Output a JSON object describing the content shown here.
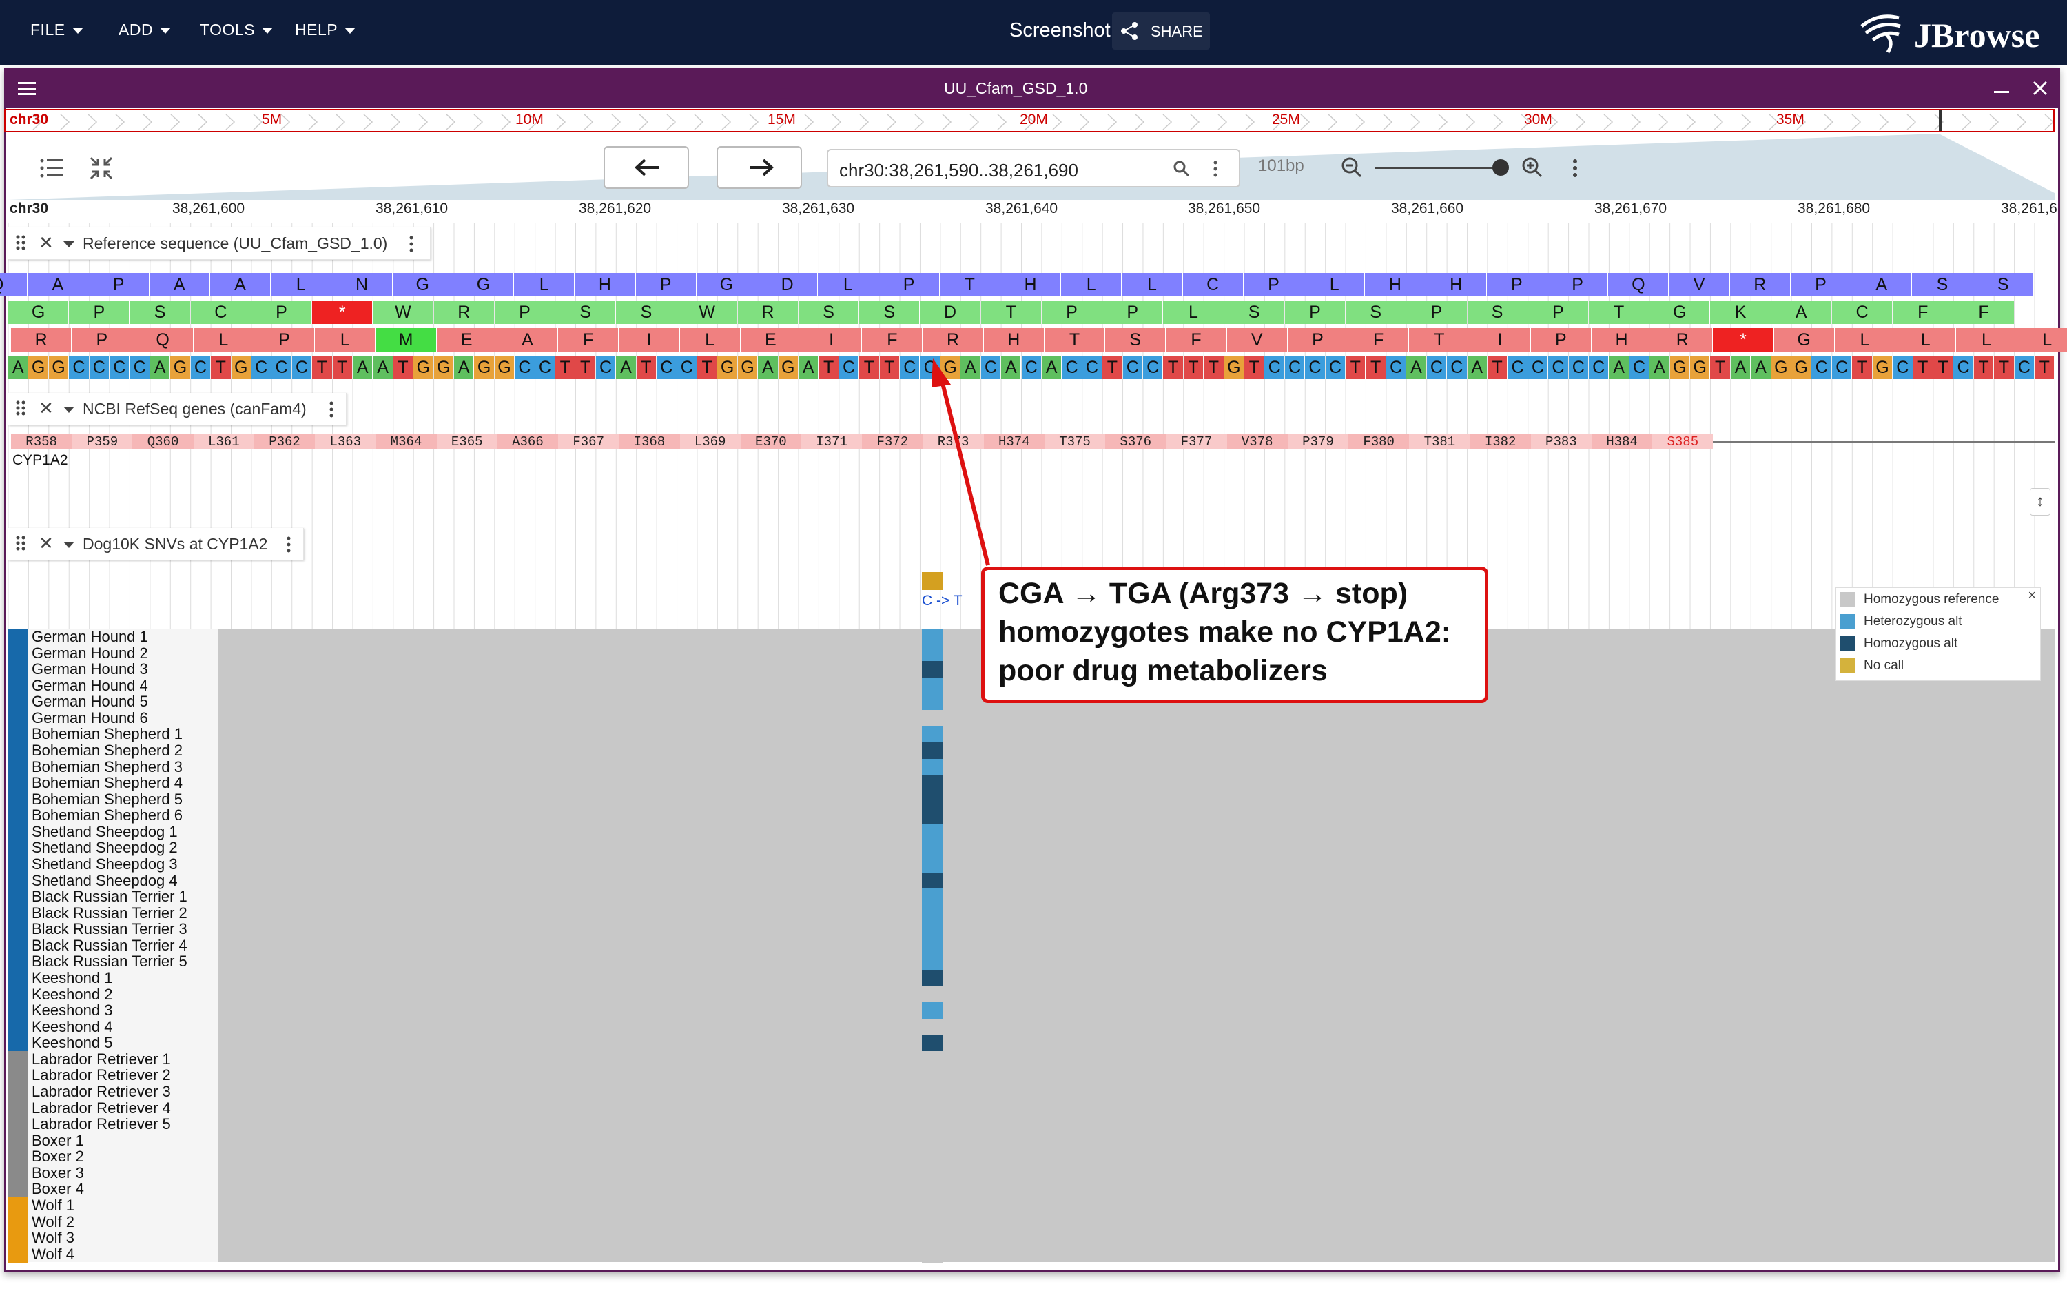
{
  "appbar": {
    "menus": [
      "FILE",
      "ADD",
      "TOOLS",
      "HELP"
    ],
    "screenshot_label": "Screenshot",
    "share_label": "SHARE",
    "logo_text": "JBrowse"
  },
  "view": {
    "title": "UU_Cfam_GSD_1.0",
    "overview": {
      "chrom": "chr30",
      "ticks": [
        "5M",
        "10M",
        "15M",
        "20M",
        "25M",
        "30M",
        "35M"
      ]
    },
    "location": "chr30:38,261,590..38,261,690",
    "bp_width": "101bp",
    "ruler": {
      "chrom": "chr30",
      "ticks": [
        "38,261,600",
        "38,261,610",
        "38,261,620",
        "38,261,630",
        "38,261,640",
        "38,261,650",
        "38,261,660",
        "38,261,670",
        "38,261,680",
        "38,261,6"
      ]
    }
  },
  "tracks": {
    "reference": {
      "name": "Reference sequence (UU_Cfam_GSD_1.0)",
      "frame1": [
        "Q",
        "A",
        "P",
        "A",
        "A",
        "L",
        "N",
        "G",
        "G",
        "L",
        "H",
        "P",
        "G",
        "D",
        "L",
        "P",
        "T",
        "H",
        "L",
        "L",
        "C",
        "P",
        "L",
        "H",
        "H",
        "P",
        "P",
        "Q",
        "V",
        "R",
        "P",
        "A",
        "S",
        "S"
      ],
      "frame2": [
        "G",
        "P",
        "S",
        "C",
        "P",
        "*",
        "W",
        "R",
        "P",
        "S",
        "S",
        "W",
        "R",
        "S",
        "S",
        "D",
        "T",
        "P",
        "P",
        "L",
        "S",
        "P",
        "S",
        "P",
        "S",
        "P",
        "T",
        "G",
        "K",
        "A",
        "C",
        "F",
        "F"
      ],
      "frame3": [
        "R",
        "P",
        "Q",
        "L",
        "P",
        "L",
        "M",
        "E",
        "A",
        "F",
        "I",
        "L",
        "E",
        "I",
        "F",
        "R",
        "H",
        "T",
        "S",
        "F",
        "V",
        "P",
        "F",
        "T",
        "I",
        "P",
        "H",
        "R",
        "*",
        "G",
        "L",
        "L",
        "L",
        "L"
      ],
      "dna": "AGGCCCCAGCTGCCCTTAATGGAGGCCTTCATCCTGGAGATCTTCCGACACACCTCCTTTGTCCCCTTCACCATCCCCCACAGGTAAGGCCTGCTTCTTCT"
    },
    "genes": {
      "name": "NCBI RefSeq genes (canFam4)",
      "gene_name": "CYP1A2",
      "residues": [
        "R358",
        "P359",
        "Q360",
        "L361",
        "P362",
        "L363",
        "M364",
        "E365",
        "A366",
        "F367",
        "I368",
        "L369",
        "E370",
        "I371",
        "F372",
        "R373",
        "H374",
        "T375",
        "S376",
        "F377",
        "V378",
        "P379",
        "F380",
        "T381",
        "I382",
        "P383",
        "H384",
        "S385"
      ]
    },
    "snvs": {
      "name": "Dog10K SNVs at CYP1A2",
      "variant_label": "C -> T",
      "samples": [
        {
          "name": "German Hound 1",
          "group": "German Hound",
          "gt": "het"
        },
        {
          "name": "German Hound 2",
          "group": "German Hound",
          "gt": "het"
        },
        {
          "name": "German Hound 3",
          "group": "German Hound",
          "gt": "homalt"
        },
        {
          "name": "German Hound 4",
          "group": "German Hound",
          "gt": "het"
        },
        {
          "name": "German Hound 5",
          "group": "German Hound",
          "gt": "het"
        },
        {
          "name": "German Hound 6",
          "group": "German Hound",
          "gt": "ref"
        },
        {
          "name": "Bohemian Shepherd 1",
          "group": "Bohemian Shepherd",
          "gt": "het"
        },
        {
          "name": "Bohemian Shepherd 2",
          "group": "Bohemian Shepherd",
          "gt": "homalt"
        },
        {
          "name": "Bohemian Shepherd 3",
          "group": "Bohemian Shepherd",
          "gt": "het"
        },
        {
          "name": "Bohemian Shepherd 4",
          "group": "Bohemian Shepherd",
          "gt": "homalt"
        },
        {
          "name": "Bohemian Shepherd 5",
          "group": "Bohemian Shepherd",
          "gt": "homalt"
        },
        {
          "name": "Bohemian Shepherd 6",
          "group": "Bohemian Shepherd",
          "gt": "homalt"
        },
        {
          "name": "Shetland Sheepdog 1",
          "group": "Shetland Sheepdog",
          "gt": "het"
        },
        {
          "name": "Shetland Sheepdog 2",
          "group": "Shetland Sheepdog",
          "gt": "het"
        },
        {
          "name": "Shetland Sheepdog 3",
          "group": "Shetland Sheepdog",
          "gt": "het"
        },
        {
          "name": "Shetland Sheepdog 4",
          "group": "Shetland Sheepdog",
          "gt": "homalt"
        },
        {
          "name": "Black Russian Terrier 1",
          "group": "Black Russian Terrier",
          "gt": "het"
        },
        {
          "name": "Black Russian Terrier 2",
          "group": "Black Russian Terrier",
          "gt": "het"
        },
        {
          "name": "Black Russian Terrier 3",
          "group": "Black Russian Terrier",
          "gt": "het"
        },
        {
          "name": "Black Russian Terrier 4",
          "group": "Black Russian Terrier",
          "gt": "het"
        },
        {
          "name": "Black Russian Terrier 5",
          "group": "Black Russian Terrier",
          "gt": "het"
        },
        {
          "name": "Keeshond 1",
          "group": "Keeshond",
          "gt": "homalt"
        },
        {
          "name": "Keeshond 2",
          "group": "Keeshond",
          "gt": "ref"
        },
        {
          "name": "Keeshond 3",
          "group": "Keeshond",
          "gt": "het"
        },
        {
          "name": "Keeshond 4",
          "group": "Keeshond",
          "gt": "ref"
        },
        {
          "name": "Keeshond 5",
          "group": "Keeshond",
          "gt": "homalt"
        },
        {
          "name": "Labrador Retriever 1",
          "group": "Labrador Retriever",
          "gt": "ref"
        },
        {
          "name": "Labrador Retriever 2",
          "group": "Labrador Retriever",
          "gt": "ref"
        },
        {
          "name": "Labrador Retriever 3",
          "group": "Labrador Retriever",
          "gt": "ref"
        },
        {
          "name": "Labrador Retriever 4",
          "group": "Labrador Retriever",
          "gt": "ref"
        },
        {
          "name": "Labrador Retriever 5",
          "group": "Labrador Retriever",
          "gt": "ref"
        },
        {
          "name": "Boxer 1",
          "group": "Boxer",
          "gt": "ref"
        },
        {
          "name": "Boxer 2",
          "group": "Boxer",
          "gt": "ref"
        },
        {
          "name": "Boxer 3",
          "group": "Boxer",
          "gt": "ref"
        },
        {
          "name": "Boxer 4",
          "group": "Boxer",
          "gt": "ref"
        },
        {
          "name": "Wolf 1",
          "group": "Wolf",
          "gt": "ref"
        },
        {
          "name": "Wolf 2",
          "group": "Wolf",
          "gt": "ref"
        },
        {
          "name": "Wolf 3",
          "group": "Wolf",
          "gt": "ref"
        },
        {
          "name": "Wolf 4",
          "group": "Wolf",
          "gt": "ref"
        }
      ],
      "legend": {
        "items": [
          {
            "label": "Homozygous reference",
            "color": "#c8c8c8"
          },
          {
            "label": "Heterozygous alt",
            "color": "#4a9fd0"
          },
          {
            "label": "Homozygous alt",
            "color": "#1f4e6e"
          },
          {
            "label": "No call",
            "color": "#d4b23c"
          }
        ]
      }
    }
  },
  "annotation": {
    "lines": [
      "CGA → TGA (Arg373 → stop)",
      "homozygotes make no CYP1A2:",
      "poor drug metabolizers"
    ]
  },
  "colors": {
    "appbar": "#0e1c3a",
    "view_border": "#5a1a58",
    "frame1": "#8080ff",
    "frame2": "#80e080",
    "frame3": "#f08080",
    "stop": "#ee2222",
    "start": "#44dd44",
    "base_A": "#5fbf5f",
    "base_C": "#3b9ddd",
    "base_G": "#e8a23a",
    "base_T": "#e04848",
    "het": "#4a9fd0",
    "homalt": "#1f4e6e",
    "ref": "#c8c8c8",
    "nocall": "#d4b23c",
    "callout": "#dd1111"
  }
}
